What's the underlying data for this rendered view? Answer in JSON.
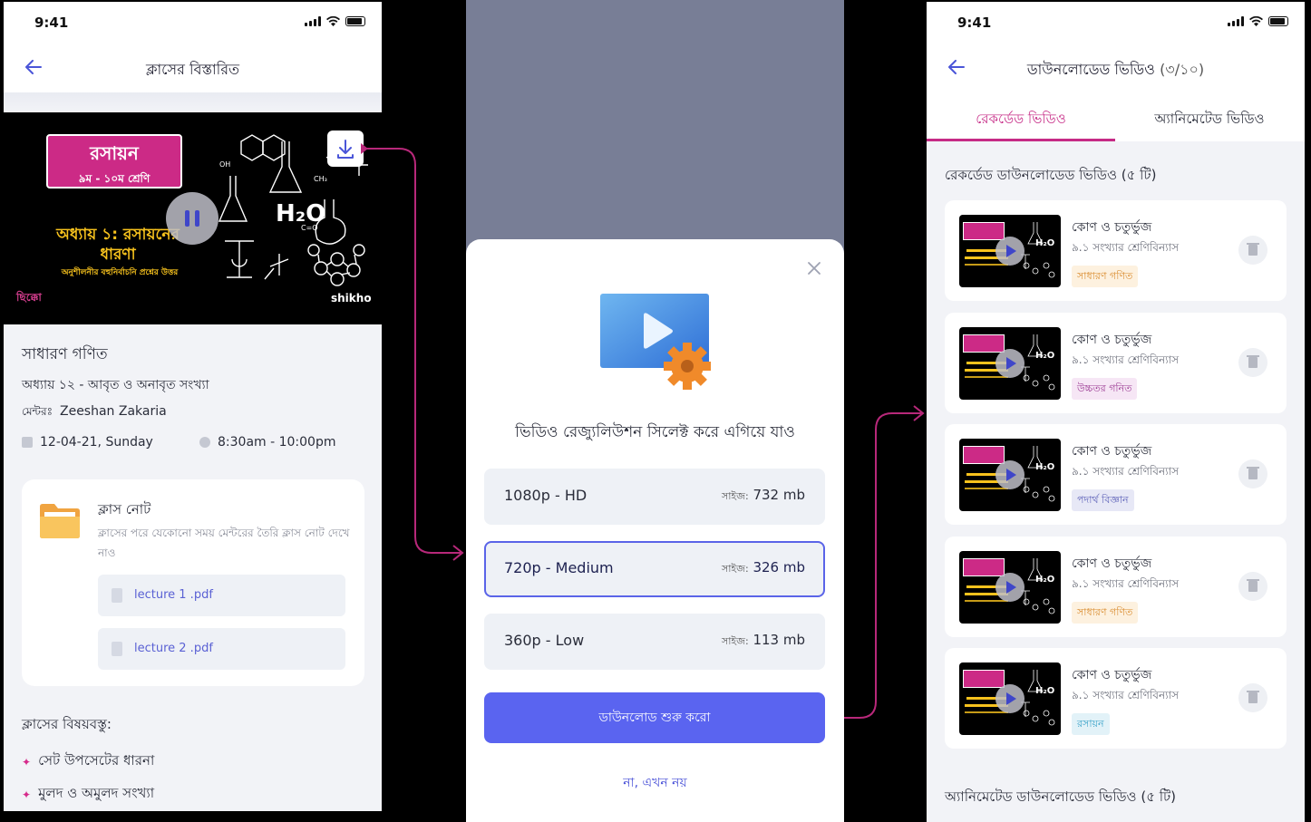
{
  "status": {
    "time": "9:41"
  },
  "screen1": {
    "header_title": "ক্লাসের বিস্তারিত",
    "video": {
      "subject": "রসায়ন",
      "grade": "৯ম - ১০ম শ্রেণি",
      "chapter": "অধ্যায় ১: রসায়নের ধারণা",
      "chapter_sub": "অনুশীলনীর বহুনির্বাচনি প্রশ্নের উত্তর",
      "formula": "H₂O",
      "logo_left": "ছিক্কো",
      "logo_right": "shikho"
    },
    "subject": "সাধারণ গণিত",
    "chapter": "অধ্যায় ১২ - আবৃত ও অনাবৃত সংখ্যা",
    "mentor_label": "মেন্টরঃ",
    "mentor_name": "Zeeshan Zakaria",
    "date": "12-04-21, Sunday",
    "time": "8:30am - 10:00pm",
    "note": {
      "title": "ক্লাস নোট",
      "desc": "ক্লাসের পরে যেকোনো সময় মেন্টরের তৈরি ক্লাস নোট দেখে নাও",
      "files": [
        "lecture 1 .pdf",
        "lecture 2 .pdf"
      ]
    },
    "topics_title": "ক্লাসের বিষয়বস্তু:",
    "topics": [
      "সেট উপসেটের ধারনা",
      "মুলদ ও অমুলদ সংখ্যা"
    ]
  },
  "screen2": {
    "modal_title": "ভিডিও রেজ্যুলিউশন সিলেক্ট করে এগিয়ে যাও",
    "size_label": "সাইজ:",
    "options": [
      {
        "label": "1080p - HD",
        "size": "732 mb",
        "selected": false
      },
      {
        "label": "720p - Medium",
        "size": "326 mb",
        "selected": true
      },
      {
        "label": "360p - Low",
        "size": "113 mb",
        "selected": false
      }
    ],
    "start_button": "ডাউনলোড শুরু করো",
    "cancel_link": "না, এখন নয়"
  },
  "screen3": {
    "header_title": "ডাউনলোডেড ভিডিও",
    "header_count": "(৩/১০)",
    "tabs": [
      "রেকর্ডেড ভিডিও",
      "অ্যানিমেটেড ভিডিও"
    ],
    "recorded_title": "রেকর্ডেড ডাউনলোডেড ভিডিও (৫ টি)",
    "animated_title": "অ্যানিমেটেড ডাউনলোডেড ভিডিও (৫ টি)",
    "videos": [
      {
        "title": "কোণ ও চতুর্ভুজ",
        "sub": "৯.১ সংখ্যার শ্রেণিবিন্যাস",
        "tag": "সাধারণ গণিত",
        "tag_bg": "#fdf1df",
        "tag_fg": "#d98a2b"
      },
      {
        "title": "কোণ ও চতুর্ভুজ",
        "sub": "৯.১ সংখ্যার শ্রেণিবিন্যাস",
        "tag": "উচ্চতর গনিত",
        "tag_bg": "#f6e6f5",
        "tag_fg": "#9b3a93"
      },
      {
        "title": "কোণ ও চতুর্ভুজ",
        "sub": "৯.১ সংখ্যার শ্রেণিবিন্যাস",
        "tag": "পদার্থ বিজ্ঞান",
        "tag_bg": "#e7e8f6",
        "tag_fg": "#5c60b8"
      },
      {
        "title": "কোণ ও চতুর্ভুজ",
        "sub": "৯.১ সংখ্যার শ্রেণিবিন্যাস",
        "tag": "সাধারণ গণিত",
        "tag_bg": "#fdf1df",
        "tag_fg": "#d98a2b"
      },
      {
        "title": "কোণ ও চতুর্ভুজ",
        "sub": "৯.১ সংখ্যার শ্রেণিবিন্যাস",
        "tag": "রসায়ন",
        "tag_bg": "#e2f2f8",
        "tag_fg": "#3aa3c9"
      }
    ]
  },
  "colors": {
    "accent": "#5a64f0",
    "brand_pink": "#c62a86",
    "flow_arrow": "#b8287a"
  }
}
